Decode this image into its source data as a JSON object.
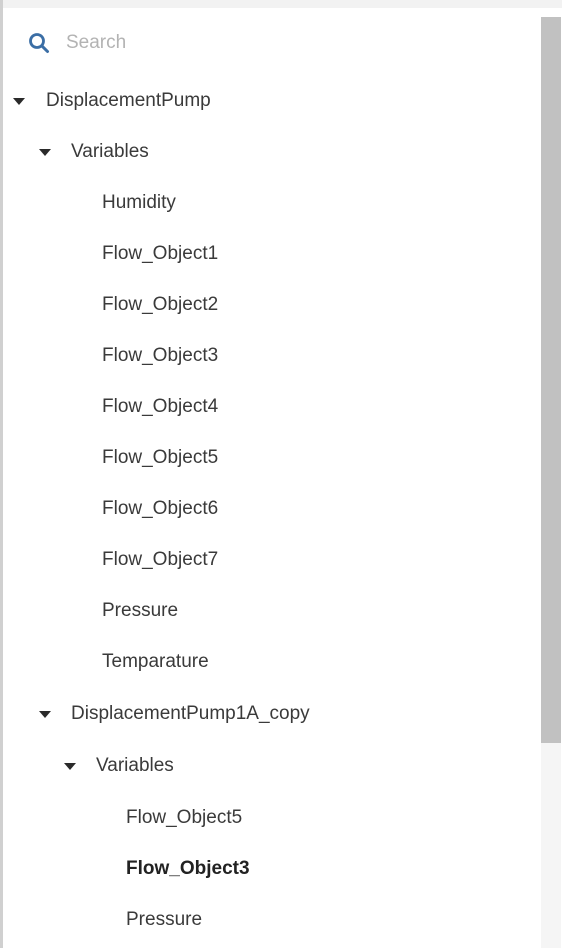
{
  "search": {
    "placeholder": "Search",
    "icon": "search-icon"
  },
  "tree": {
    "nodes": [
      {
        "label": "DisplacementPump",
        "level": 0,
        "expanded": true
      },
      {
        "label": "Variables",
        "level": 1,
        "expanded": true
      },
      {
        "label": "Humidity",
        "level": 2
      },
      {
        "label": "Flow_Object1",
        "level": 2
      },
      {
        "label": "Flow_Object2",
        "level": 2
      },
      {
        "label": "Flow_Object3",
        "level": 2
      },
      {
        "label": "Flow_Object4",
        "level": 2
      },
      {
        "label": "Flow_Object5",
        "level": 2
      },
      {
        "label": "Flow_Object6",
        "level": 2
      },
      {
        "label": "Flow_Object7",
        "level": 2
      },
      {
        "label": "Pressure",
        "level": 2
      },
      {
        "label": "Temparature",
        "level": 2
      },
      {
        "label": "DisplacementPump1A_copy",
        "level": 1,
        "expanded": true
      },
      {
        "label": "Variables",
        "level": 2,
        "expanded": true
      },
      {
        "label": "Flow_Object5",
        "level": 3
      },
      {
        "label": "Flow_Object3",
        "level": 3,
        "selected": true
      },
      {
        "label": "Pressure",
        "level": 3
      }
    ]
  },
  "colors": {
    "search_icon": "#3b6ea5",
    "text": "#3a3a3a",
    "scrollbar_thumb": "#c1c1c1"
  }
}
